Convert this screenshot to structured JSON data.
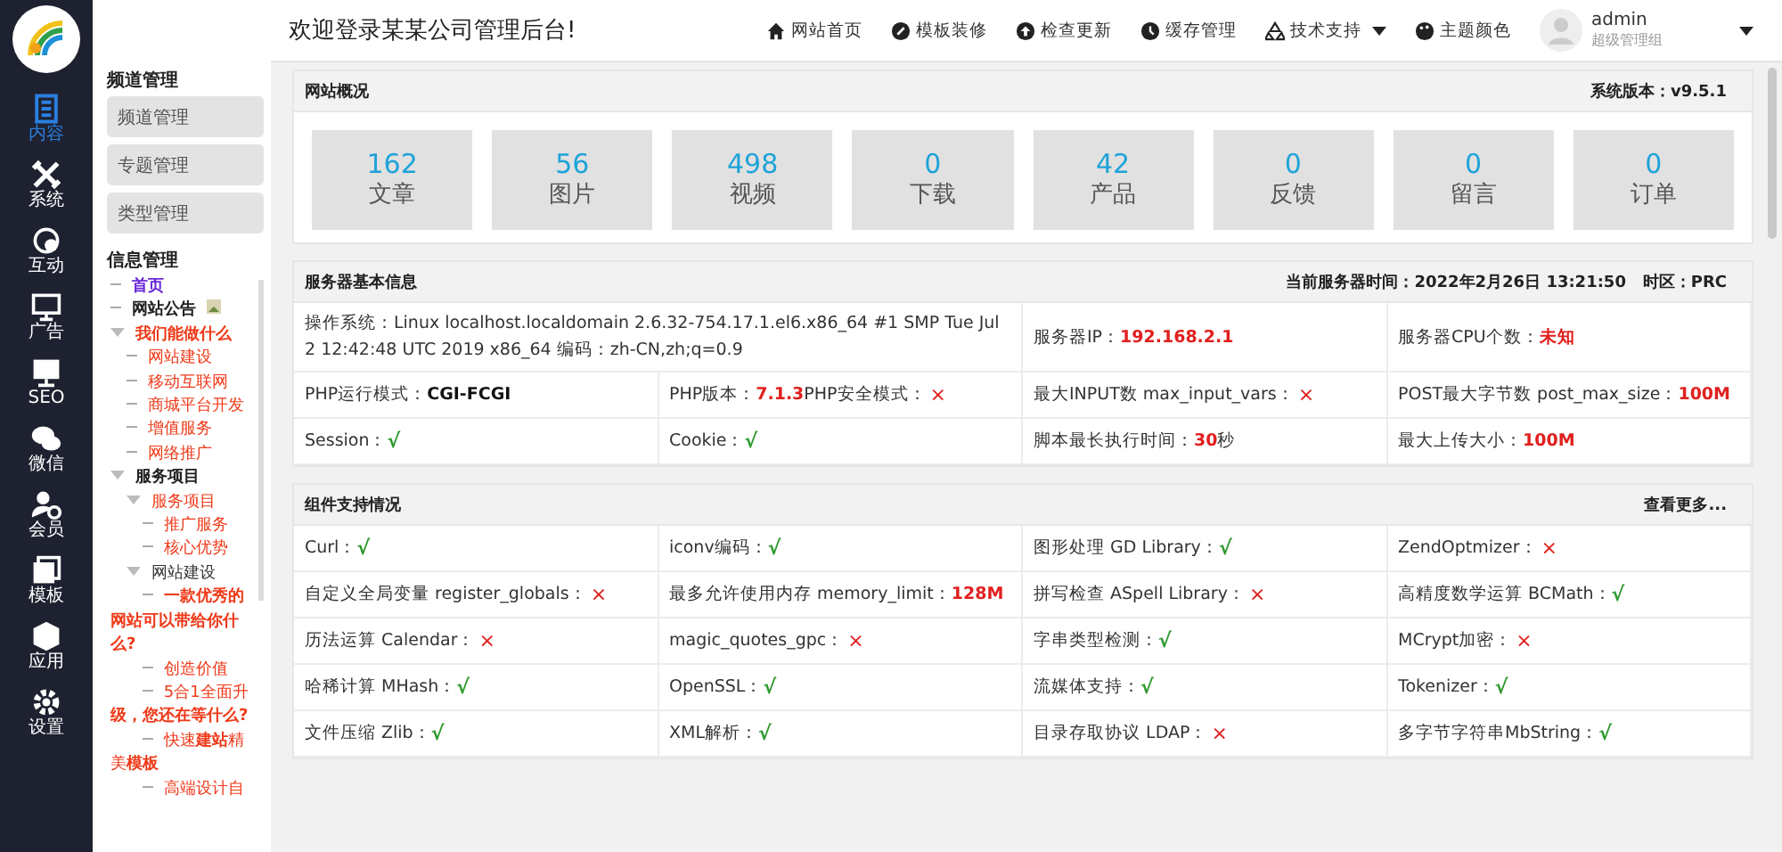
{
  "header": {
    "title": "欢迎登录某某公司管理后台!",
    "nav": [
      {
        "label": "网站首页",
        "dropdown": false
      },
      {
        "label": "模板装修",
        "dropdown": false
      },
      {
        "label": "检查更新",
        "dropdown": false
      },
      {
        "label": "缓存管理",
        "dropdown": false
      },
      {
        "label": "技术支持",
        "dropdown": true
      },
      {
        "label": "主题颜色",
        "dropdown": false
      }
    ],
    "user": {
      "name": "admin",
      "role": "超级管理组"
    }
  },
  "nav_rail": [
    {
      "label": "内容",
      "selected": true
    },
    {
      "label": "系统",
      "selected": false
    },
    {
      "label": "互动",
      "selected": false
    },
    {
      "label": "广告",
      "selected": false
    },
    {
      "label": "SEO",
      "selected": false
    },
    {
      "label": "微信",
      "selected": false
    },
    {
      "label": "会员",
      "selected": false
    },
    {
      "label": "模板",
      "selected": false
    },
    {
      "label": "应用",
      "selected": false
    },
    {
      "label": "设置",
      "selected": false
    }
  ],
  "sidebar": {
    "channel_heading": "频道管理",
    "channel_buttons": [
      "频道管理",
      "专题管理",
      "类型管理"
    ],
    "info_heading": "信息管理",
    "tree": [
      {
        "label": "首页",
        "kind": "page",
        "selected": true
      },
      {
        "label": "网站公告",
        "kind": "heading",
        "selected": false,
        "badge": true
      },
      {
        "label": "我们能做什么",
        "kind": "featured",
        "selected": false,
        "expanded": true,
        "children": [
          {
            "label": "网站建设",
            "kind": "link",
            "selected": false
          },
          {
            "label": "移动互联网",
            "kind": "link",
            "selected": false
          },
          {
            "label": "商城平台开发",
            "kind": "link",
            "selected": false
          },
          {
            "label": "增值服务",
            "kind": "link",
            "selected": false
          },
          {
            "label": "网络推广",
            "kind": "link",
            "selected": false
          }
        ]
      },
      {
        "label": "服务项目",
        "kind": "heading",
        "selected": false,
        "expanded": true,
        "children": [
          {
            "label": "服务项目",
            "kind": "link",
            "selected": false,
            "expanded": true,
            "children": [
              {
                "label": "推广服务",
                "kind": "link",
                "selected": false
              },
              {
                "label": "核心优势",
                "kind": "link",
                "selected": false
              }
            ]
          },
          {
            "label": "网站建设",
            "kind": "folder",
            "selected": false,
            "expanded": true,
            "children": [
              {
                "label": "一款优秀的网站可以带给你什么?",
                "kind": "featured",
                "selected": false
              },
              {
                "label": "创造价值",
                "kind": "link",
                "selected": false
              },
              {
                "label": "5合1全面升**级，您还在等什么?**",
                "kind": "link",
                "selected": false
              },
              {
                "label": "快速**建站**精美**模板**",
                "kind": "link",
                "selected": false
              },
              {
                "label": "高端设计自",
                "kind": "link",
                "selected": false
              }
            ]
          }
        ]
      }
    ]
  },
  "overview": {
    "title": "网站概况",
    "version_label": "系统版本：",
    "version": "v9.5.1",
    "stats": [
      {
        "value": "162",
        "label": "文章"
      },
      {
        "value": "56",
        "label": "图片"
      },
      {
        "value": "498",
        "label": "视频"
      },
      {
        "value": "0",
        "label": "下载"
      },
      {
        "value": "42",
        "label": "产品"
      },
      {
        "value": "0",
        "label": "反馈"
      },
      {
        "value": "0",
        "label": "留言"
      },
      {
        "value": "0",
        "label": "订单"
      }
    ]
  },
  "server": {
    "title": "服务器基本信息",
    "time_label": "当前服务器时间：",
    "time": "2022年2月26日 13:21:50",
    "zone_label": "时区：",
    "zone": "PRC",
    "rows": [
      [
        {
          "parts": [
            {
              "text": "操作系统：Linux localhost.localdomain 2.6.32-754.17.1.el6.x86_64 #1 SMP Tue Jul 2 12:42:48 UTC 2019 x86_64 编码：zh-CN,zh;q=0.9",
              "kind": "plain"
            }
          ]
        },
        "",
        {
          "parts": [
            {
              "text": "服务器IP：",
              "kind": "plain"
            },
            {
              "text": "192.168.2.1",
              "kind": "red"
            }
          ]
        },
        {
          "parts": [
            {
              "text": "服务器CPU个数：",
              "kind": "plain"
            },
            {
              "text": "未知",
              "kind": "red"
            }
          ]
        }
      ],
      [
        {
          "parts": [
            {
              "text": "PHP运行模式：",
              "kind": "plain"
            },
            {
              "text": "CGI-FCGI",
              "kind": "bold"
            }
          ]
        },
        {
          "parts": [
            {
              "text": "PHP版本：",
              "kind": "plain"
            },
            {
              "text": "7.1.3",
              "kind": "red"
            },
            {
              "text": " PHP安全模式：",
              "kind": "plain"
            },
            {
              "text": "×",
              "kind": "no"
            }
          ]
        },
        {
          "parts": [
            {
              "text": "最大INPUT数 max_input_vars：",
              "kind": "plain"
            },
            {
              "text": "×",
              "kind": "no"
            }
          ]
        },
        {
          "parts": [
            {
              "text": "POST最大字节数 post_max_size：",
              "kind": "plain"
            },
            {
              "text": "100M",
              "kind": "red"
            }
          ]
        }
      ],
      [
        {
          "parts": [
            {
              "text": "Session：",
              "kind": "plain"
            },
            {
              "text": "√",
              "kind": "ok"
            }
          ]
        },
        {
          "parts": [
            {
              "text": "Cookie：",
              "kind": "plain"
            },
            {
              "text": "√",
              "kind": "ok"
            }
          ]
        },
        {
          "parts": [
            {
              "text": "脚本最长执行时间：",
              "kind": "plain"
            },
            {
              "text": "30",
              "kind": "red"
            },
            {
              "text": "秒",
              "kind": "plain"
            }
          ]
        },
        {
          "parts": [
            {
              "text": "最大上传大小：",
              "kind": "plain"
            },
            {
              "text": "100M",
              "kind": "red"
            }
          ]
        }
      ]
    ]
  },
  "components": {
    "title": "组件支持情况",
    "more": "查看更多...",
    "rows": [
      [
        {
          "parts": [
            {
              "text": "Curl：",
              "kind": "plain"
            },
            {
              "text": "√",
              "kind": "ok"
            }
          ]
        },
        {
          "parts": [
            {
              "text": "iconv编码：",
              "kind": "plain"
            },
            {
              "text": "√",
              "kind": "ok"
            }
          ]
        },
        {
          "parts": [
            {
              "text": "图形处理 GD Library：",
              "kind": "plain"
            },
            {
              "text": "√",
              "kind": "ok"
            }
          ]
        },
        {
          "parts": [
            {
              "text": "ZendOptmizer：",
              "kind": "plain"
            },
            {
              "text": "×",
              "kind": "no"
            }
          ]
        }
      ],
      [
        {
          "parts": [
            {
              "text": "自定义全局变量 register_globals：",
              "kind": "plain"
            },
            {
              "text": "×",
              "kind": "no"
            }
          ]
        },
        {
          "parts": [
            {
              "text": "最多允许使用内存 memory_limit：",
              "kind": "plain"
            },
            {
              "text": "128M",
              "kind": "red"
            }
          ]
        },
        {
          "parts": [
            {
              "text": "拼写检查 ASpell Library：",
              "kind": "plain"
            },
            {
              "text": "×",
              "kind": "no"
            }
          ]
        },
        {
          "parts": [
            {
              "text": "高精度数学运算 BCMath：",
              "kind": "plain"
            },
            {
              "text": "√",
              "kind": "ok"
            }
          ]
        }
      ],
      [
        {
          "parts": [
            {
              "text": "历法运算 Calendar：",
              "kind": "plain"
            },
            {
              "text": "×",
              "kind": "no"
            }
          ]
        },
        {
          "parts": [
            {
              "text": "magic_quotes_gpc：",
              "kind": "plain"
            },
            {
              "text": "×",
              "kind": "no"
            }
          ]
        },
        {
          "parts": [
            {
              "text": "字串类型检测：",
              "kind": "plain"
            },
            {
              "text": "√",
              "kind": "ok"
            }
          ]
        },
        {
          "parts": [
            {
              "text": "MCrypt加密：",
              "kind": "plain"
            },
            {
              "text": "×",
              "kind": "no"
            }
          ]
        }
      ],
      [
        {
          "parts": [
            {
              "text": "哈稀计算 MHash：",
              "kind": "plain"
            },
            {
              "text": "√",
              "kind": "ok"
            }
          ]
        },
        {
          "parts": [
            {
              "text": "OpenSSL：",
              "kind": "plain"
            },
            {
              "text": "√",
              "kind": "ok"
            }
          ]
        },
        {
          "parts": [
            {
              "text": "流媒体支持：",
              "kind": "plain"
            },
            {
              "text": "√",
              "kind": "ok"
            }
          ]
        },
        {
          "parts": [
            {
              "text": "Tokenizer：",
              "kind": "plain"
            },
            {
              "text": "√",
              "kind": "ok"
            }
          ]
        }
      ],
      [
        {
          "parts": [
            {
              "text": "文件压缩 Zlib：",
              "kind": "plain"
            },
            {
              "text": "√",
              "kind": "ok"
            }
          ]
        },
        {
          "parts": [
            {
              "text": "XML解析：",
              "kind": "plain"
            },
            {
              "text": "√",
              "kind": "ok"
            }
          ]
        },
        {
          "parts": [
            {
              "text": "目录存取协议 LDAP：",
              "kind": "plain"
            },
            {
              "text": "×",
              "kind": "no"
            }
          ]
        },
        {
          "parts": [
            {
              "text": "多字节字符串MbString：",
              "kind": "plain"
            },
            {
              "text": "√",
              "kind": "ok"
            }
          ]
        }
      ]
    ]
  }
}
